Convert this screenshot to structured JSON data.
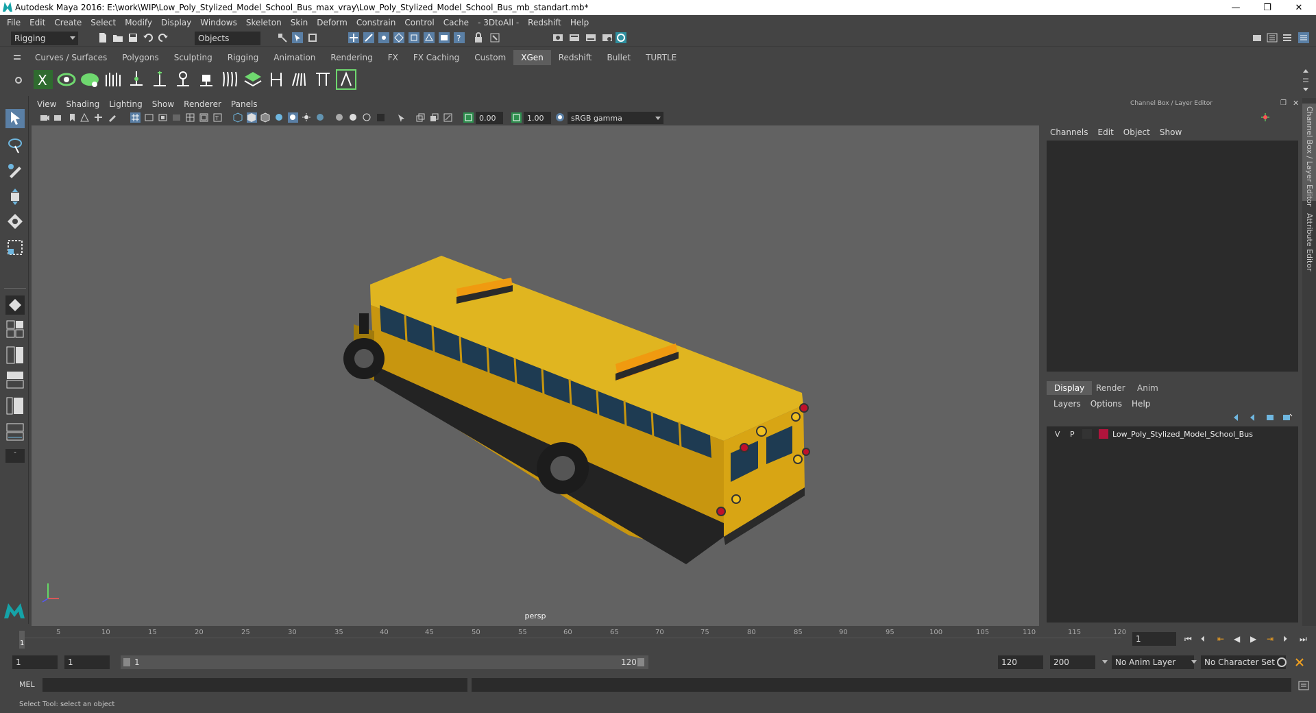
{
  "window": {
    "title": "Autodesk Maya 2016: E:\\work\\WIP\\Low_Poly_Stylized_Model_School_Bus_max_vray\\Low_Poly_Stylized_Model_School_Bus_mb_standart.mb*",
    "minimize": "—",
    "restore": "❐",
    "close": "✕"
  },
  "menubar": [
    "File",
    "Edit",
    "Create",
    "Select",
    "Modify",
    "Display",
    "Windows",
    "Skeleton",
    "Skin",
    "Deform",
    "Constrain",
    "Control",
    "Cache",
    "- 3DtoAll -",
    "Redshift",
    "Help"
  ],
  "statusline": {
    "menuset": "Rigging",
    "selection_mode": "Objects"
  },
  "shelf": {
    "tabs": [
      "Curves / Surfaces",
      "Polygons",
      "Sculpting",
      "Rigging",
      "Animation",
      "Rendering",
      "FX",
      "FX Caching",
      "Custom",
      "XGen",
      "Redshift",
      "Bullet",
      "TURTLE"
    ],
    "active_tab": "XGen"
  },
  "viewport": {
    "menus": [
      "View",
      "Shading",
      "Lighting",
      "Show",
      "Renderer",
      "Panels"
    ],
    "exposure": "0.00",
    "gamma": "1.00",
    "color_space": "sRGB gamma",
    "camera_label": "persp"
  },
  "channel_box": {
    "title": "Channel Box / Layer Editor",
    "menus": [
      "Channels",
      "Edit",
      "Object",
      "Show"
    ],
    "side_tabs": [
      "Channel Box / Layer Editor",
      "Attribute Editor"
    ]
  },
  "layer_editor": {
    "tabs": [
      "Display",
      "Render",
      "Anim"
    ],
    "active_tab": "Display",
    "menus": [
      "Layers",
      "Options",
      "Help"
    ],
    "layers": [
      {
        "visible": "V",
        "playback": "P",
        "name": "Low_Poly_Stylized_Model_School_Bus",
        "color": "#b0143c"
      }
    ]
  },
  "timeline": {
    "ticks": [
      "1",
      "5",
      "10",
      "15",
      "20",
      "25",
      "30",
      "35",
      "40",
      "45",
      "50",
      "55",
      "60",
      "65",
      "70",
      "75",
      "80",
      "85",
      "90",
      "95",
      "100",
      "105",
      "110",
      "115",
      "120"
    ],
    "current_frame": "1"
  },
  "range": {
    "start": "1",
    "playback_start": "1",
    "slider_start": "1",
    "slider_end": "120",
    "playback_end": "120",
    "end": "200",
    "anim_layer": "No Anim Layer",
    "character_set": "No Character Set"
  },
  "command_line": {
    "label": "MEL"
  },
  "help_line": "Select Tool: select an object",
  "colors": {
    "bus_yellow": "#d8a514",
    "bus_dark": "#222222",
    "window_blue": "#1e3b52",
    "beacon_orange": "#f09a10"
  }
}
